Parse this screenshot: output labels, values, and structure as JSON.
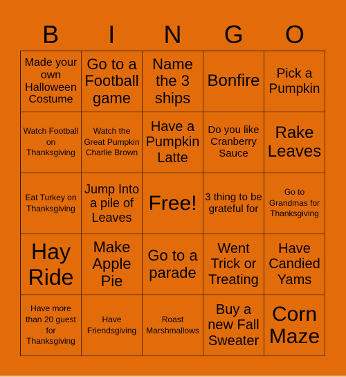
{
  "title_letters": [
    "B",
    "I",
    "N",
    "G",
    "O"
  ],
  "colors": {
    "background": "#e36c0a",
    "grid_line": "#5a2a00",
    "text": "#000000"
  },
  "cells": [
    [
      "Made your own Halloween Costume",
      "Go to a Football game",
      "Name the 3 ships",
      "Bonfire",
      "Pick a Pumpkin"
    ],
    [
      "Watch Football on Thanksgiving",
      "Watch the Great Pumpkin Charlie Brown",
      "Have a Pumpkin Latte",
      "Do you like Cranberry Sauce",
      "Rake Leaves"
    ],
    [
      "Eat Turkey on Thanksgiving",
      "Jump Into a pile of Leaves",
      "Free!",
      "3 thing to be grateful for",
      "Go to Grandmas for Thanksgiving"
    ],
    [
      "Hay Ride",
      "Make Apple Pie",
      "Go to a parade",
      "Went Trick or Treating",
      "Have Candied Yams"
    ],
    [
      "Have more than 20 guest for Thanksgiving",
      "Have Friendsgiving",
      "Roast Marshmallows",
      "Buy a new Fall Sweater",
      "Corn Maze"
    ]
  ]
}
